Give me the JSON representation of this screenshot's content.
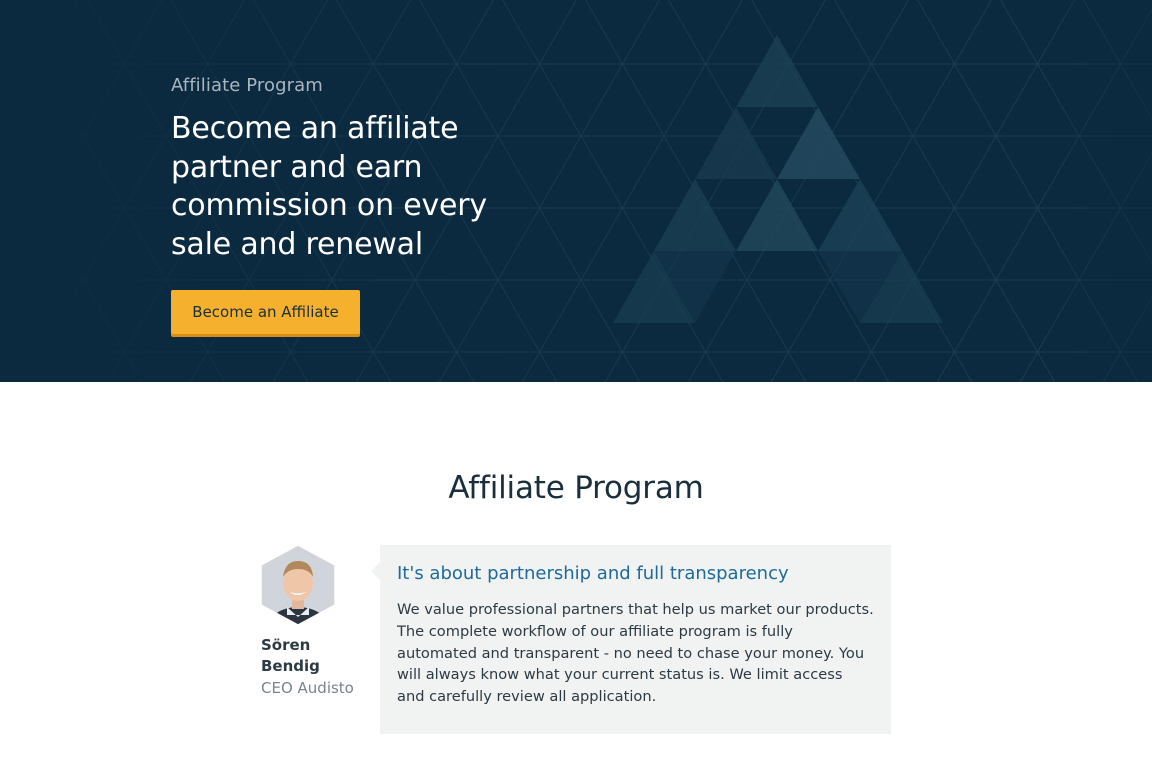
{
  "hero": {
    "eyebrow": "Affiliate Program",
    "title": "Become an affiliate partner and earn commission on every sale and renewal",
    "cta_label": "Become an Affiliate"
  },
  "section": {
    "title": "Affiliate Program"
  },
  "testimonial": {
    "name": "Sören Bendig",
    "role": "CEO Audisto",
    "heading": "It's about partnership and full transparency",
    "text": "We value professional partners that help us market our products. The complete workflow of our affiliate program is fully automated and transparent - no need to chase your money. You will always know what your current status is. We limit access and carefully review all application."
  },
  "colors": {
    "hero_background": "#0b2a3f",
    "cta_background": "#f5b02e",
    "heading_blue": "#1e6a99",
    "quote_background": "#f1f2f2"
  },
  "icons": {
    "logo_watermark": "audisto-a-logo",
    "avatar": "person-photo-hexagon"
  }
}
